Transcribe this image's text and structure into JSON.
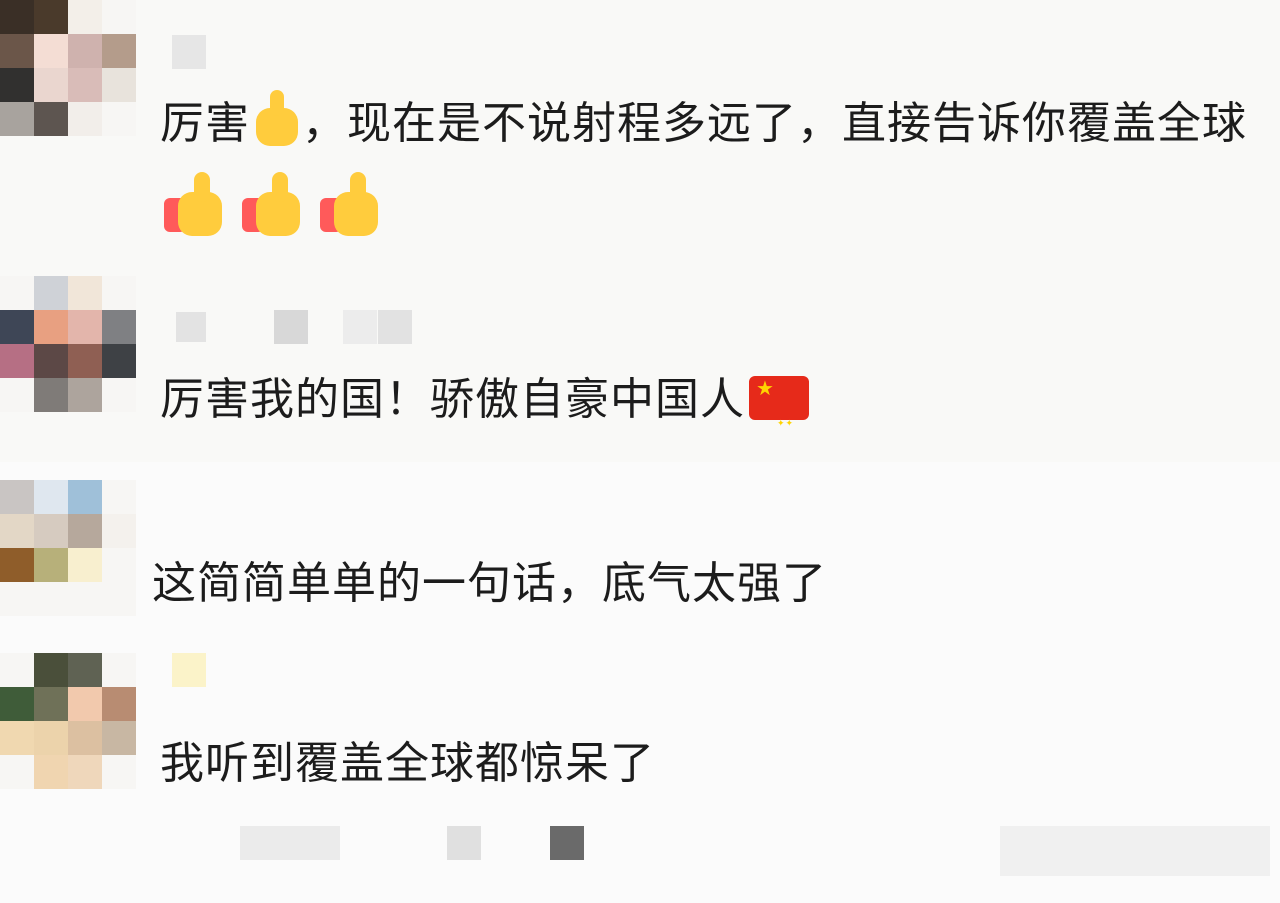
{
  "comments": [
    {
      "text_before": "厉害",
      "text_middle": "，现在是不说射程多远了，直接告诉你覆盖全球",
      "emoji": [
        "thumbs-up",
        "thumbs-up",
        "thumbs-up",
        "thumbs-up"
      ]
    },
    {
      "text": "厉害我的国！骄傲自豪中国人",
      "emoji": [
        "flag-china"
      ]
    },
    {
      "text": "这简简单单的一句话，底气太强了"
    },
    {
      "text": "我听到覆盖全球都惊呆了"
    }
  ],
  "colors": {
    "page_background": "#f7f7f7",
    "text": "#1c1c1c",
    "thumb_yellow": "#ffcc3d",
    "thumb_red": "#ff5a5a",
    "flag_red": "#e62a1a"
  }
}
